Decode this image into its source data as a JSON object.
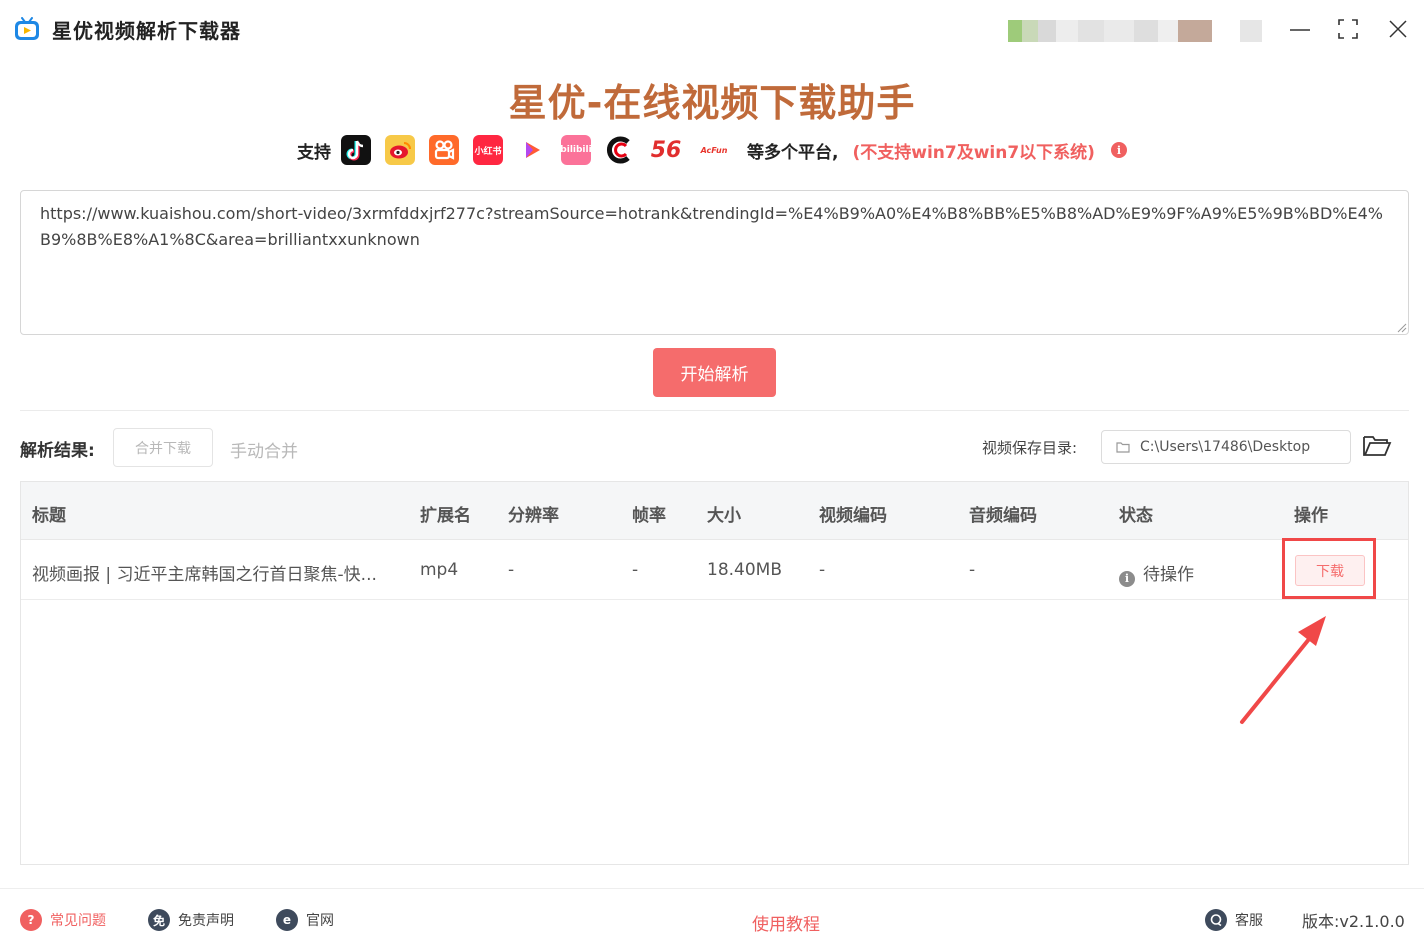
{
  "window": {
    "title": "星优视频解析下载器"
  },
  "header": {
    "title": "星优-在线视频下载助手",
    "support_label": "支持",
    "platform_xiaohongshu": "小红书",
    "platform_bilibili": "bilibili",
    "platform_56": "56",
    "platform_acfun": "AcFun",
    "support_more": "等多个平台,",
    "support_warning": "(不支持win7及win7以下系统)",
    "info_glyph": "i"
  },
  "url_input": {
    "value": "https://www.kuaishou.com/short-video/3xrmfddxjrf277c?streamSource=hotrank&trendingId=%E4%B9%A0%E4%B8%BB%E5%B8%AD%E9%9F%A9%E5%9B%BD%E4%B9%8B%E8%A1%8C&area=brilliantxxunknown"
  },
  "parse_button": "开始解析",
  "results": {
    "label": "解析结果:",
    "merge_download": "合并下载",
    "manual_merge": "手动合并",
    "save_dir_label": "视频保存目录:",
    "save_dir_value": "C:\\Users\\17486\\Desktop"
  },
  "table": {
    "columns": [
      "标题",
      "扩展名",
      "分辨率",
      "帧率",
      "大小",
      "视频编码",
      "音频编码",
      "状态",
      "操作"
    ],
    "rows": [
      {
        "title": "视频画报 | 习近平主席韩国之行首日聚焦-快...",
        "ext": "mp4",
        "resolution": "-",
        "fps": "-",
        "size": "18.40MB",
        "video_codec": "-",
        "audio_codec": "-",
        "status": "待操作",
        "action": "下载"
      }
    ]
  },
  "footer": {
    "faq": "常见问题",
    "disclaimer_glyph": "免",
    "disclaimer": "免责声明",
    "website_glyph": "e",
    "website": "官网",
    "tutorial": "使用教程",
    "service": "客服",
    "version": "版本:v2.1.0.0"
  },
  "colors": {
    "accent": "#f56c6c",
    "title_brown": "#c06a3a",
    "warning": "#f0605f",
    "highlight_frame": "#f04848"
  }
}
